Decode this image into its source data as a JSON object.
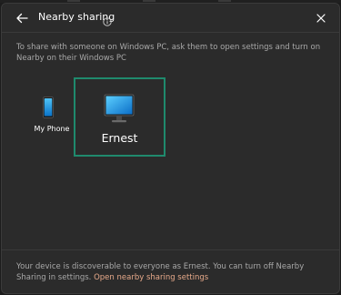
{
  "header": {
    "title": "Nearby sharing",
    "back_icon": "arrow-left-icon",
    "info_icon": "info-icon",
    "close_icon": "close-icon"
  },
  "description": "To share with someone on Windows PC, ask them to open settings and turn on Nearby on their Windows PC",
  "devices": [
    {
      "name": "My Phone",
      "icon": "phone-icon",
      "selected": false
    },
    {
      "name": "Ernest",
      "icon": "monitor-icon",
      "selected": true
    }
  ],
  "footer": {
    "text": "Your device is discoverable to everyone as Ernest. You can turn off Nearby Sharing in settings.",
    "link_label": "Open nearby sharing settings"
  },
  "colors": {
    "background": "#2b2b2b",
    "selection_border": "#1f8a6d",
    "link": "#e6a98a",
    "secondary_text": "#a8a8a8"
  }
}
